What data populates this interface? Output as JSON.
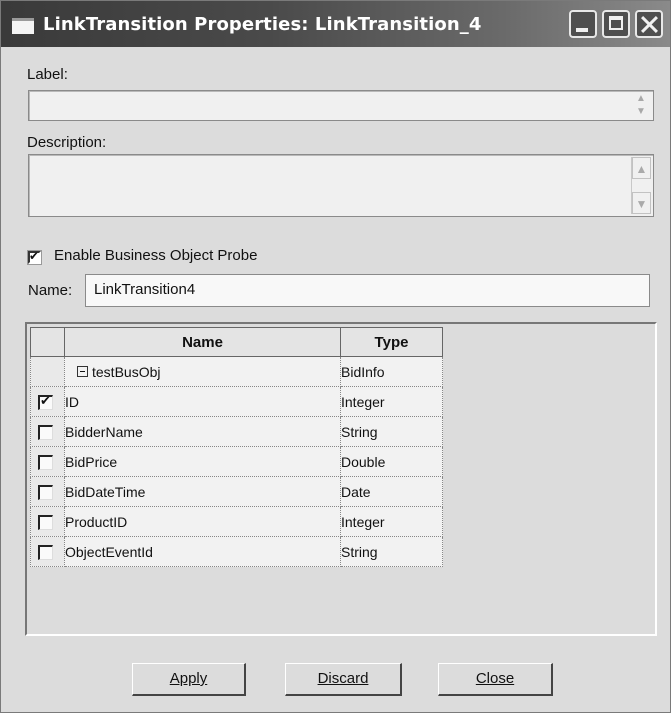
{
  "window": {
    "title": "LinkTransition Properties: LinkTransition_4"
  },
  "form": {
    "label_caption": "Label:",
    "label_value": "",
    "description_caption": "Description:",
    "description_value": "",
    "enable_probe_label": "Enable Business Object Probe",
    "enable_probe_checked": true,
    "name_caption": "Name:",
    "name_value": "LinkTransition4"
  },
  "table": {
    "columns": [
      "Name",
      "Type"
    ],
    "rows": [
      {
        "name": "testBusObj",
        "type": "BidInfo",
        "root": true
      },
      {
        "name": "ID",
        "type": "Integer",
        "checked": true
      },
      {
        "name": "BidderName",
        "type": "String",
        "checked": false
      },
      {
        "name": "BidPrice",
        "type": "Double",
        "checked": false
      },
      {
        "name": "BidDateTime",
        "type": "Date",
        "checked": false
      },
      {
        "name": "ProductID",
        "type": "Integer",
        "checked": false
      },
      {
        "name": "ObjectEventId",
        "type": "String",
        "checked": false
      }
    ]
  },
  "buttons": {
    "apply": "Apply",
    "discard": "Discard",
    "close": "Close"
  }
}
